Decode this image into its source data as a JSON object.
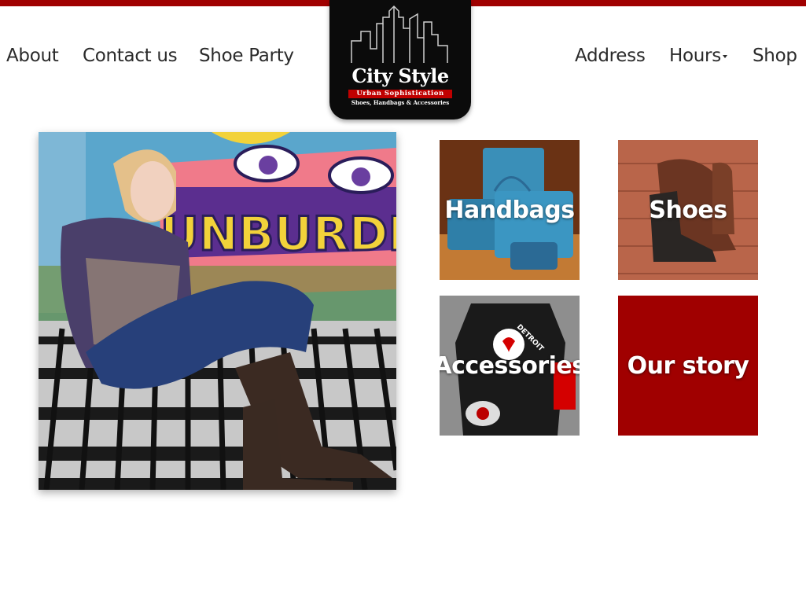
{
  "nav": {
    "left": [
      "About",
      "Contact us",
      "Shoe Party"
    ],
    "right": [
      "Address",
      "Hours",
      "Shop"
    ]
  },
  "logo": {
    "title": "City Style",
    "tagline": "Urban Sophistication",
    "subtitle": "Shoes, Handbags & Accessories"
  },
  "mural": {
    "text": "UNBURDEN"
  },
  "tiles": [
    {
      "label": "Handbags"
    },
    {
      "label": "Shoes"
    },
    {
      "label": "Accessories"
    },
    {
      "label": "Our story"
    }
  ],
  "shirt": {
    "text": "DETROIT"
  },
  "colors": {
    "brand_red": "#a00000",
    "logo_bg": "#0b0b0b"
  }
}
